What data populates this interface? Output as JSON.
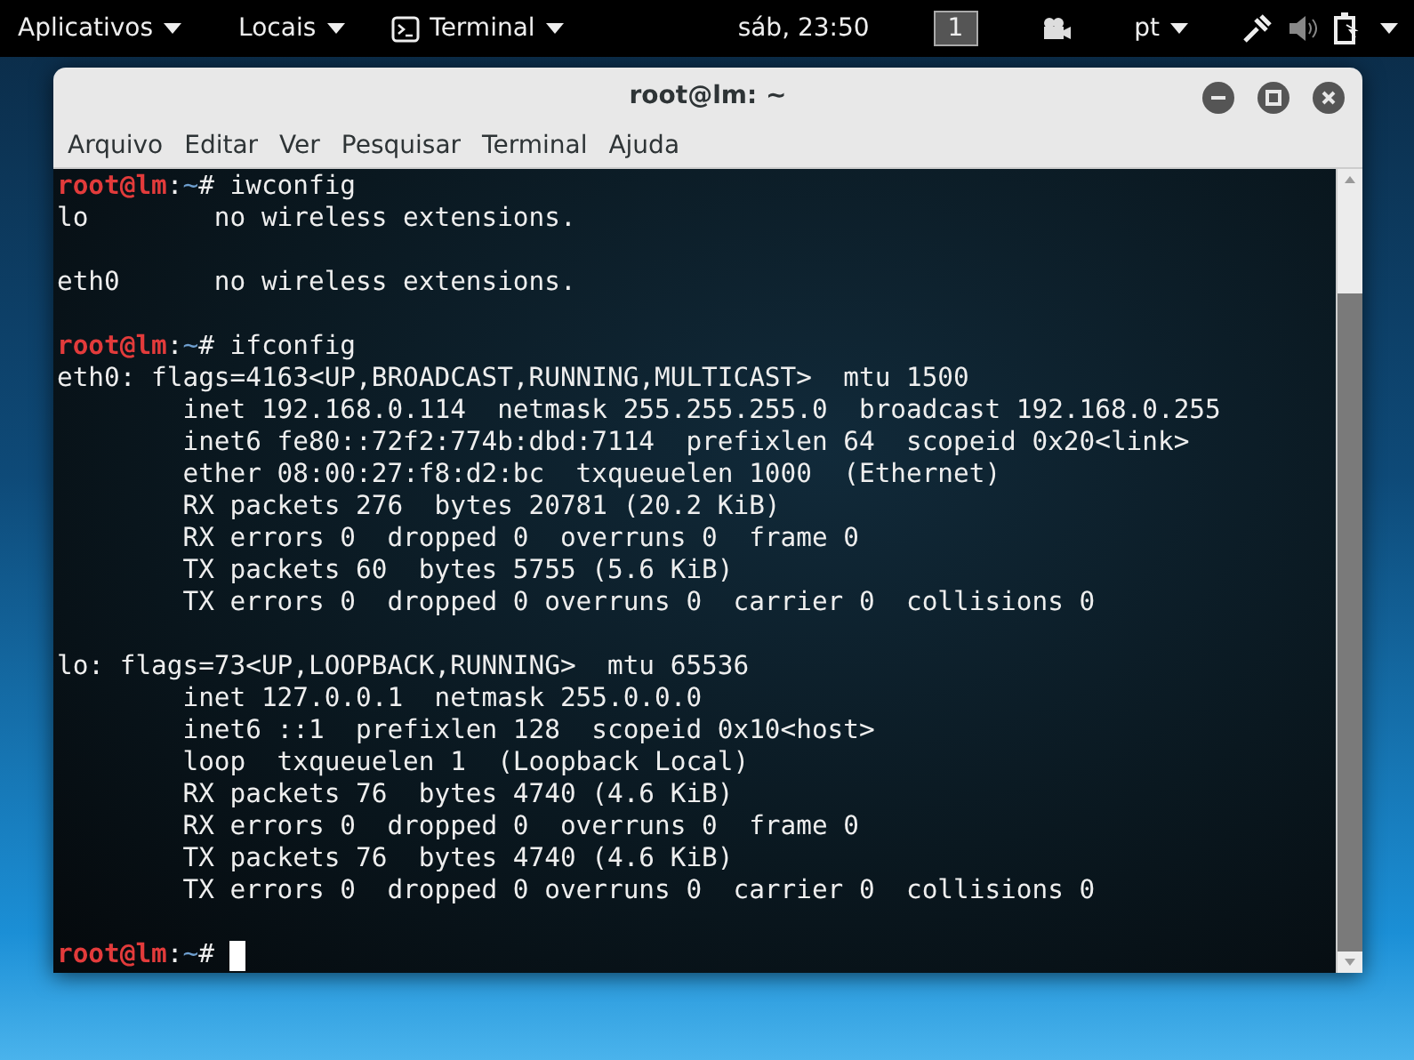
{
  "top_bar": {
    "menus": [
      {
        "label": "Aplicativos"
      },
      {
        "label": "Locais"
      },
      {
        "label": "Terminal"
      }
    ],
    "clock": "sáb, 23:50",
    "workspace": "1",
    "language": "pt"
  },
  "window": {
    "title": "root@lm: ~",
    "menu": [
      "Arquivo",
      "Editar",
      "Ver",
      "Pesquisar",
      "Terminal",
      "Ajuda"
    ]
  },
  "terminal": {
    "lines": [
      {
        "kind": "prompt",
        "user": "root@lm",
        "sep": ":",
        "path": "~",
        "symbol": "#",
        "command": " iwconfig"
      },
      {
        "kind": "output",
        "text": "lo        no wireless extensions."
      },
      {
        "kind": "blank"
      },
      {
        "kind": "output",
        "text": "eth0      no wireless extensions."
      },
      {
        "kind": "blank"
      },
      {
        "kind": "prompt",
        "user": "root@lm",
        "sep": ":",
        "path": "~",
        "symbol": "#",
        "command": " ifconfig"
      },
      {
        "kind": "output",
        "text": "eth0: flags=4163<UP,BROADCAST,RUNNING,MULTICAST>  mtu 1500"
      },
      {
        "kind": "output",
        "text": "        inet 192.168.0.114  netmask 255.255.255.0  broadcast 192.168.0.255"
      },
      {
        "kind": "output",
        "text": "        inet6 fe80::72f2:774b:dbd:7114  prefixlen 64  scopeid 0x20<link>"
      },
      {
        "kind": "output",
        "text": "        ether 08:00:27:f8:d2:bc  txqueuelen 1000  (Ethernet)"
      },
      {
        "kind": "output",
        "text": "        RX packets 276  bytes 20781 (20.2 KiB)"
      },
      {
        "kind": "output",
        "text": "        RX errors 0  dropped 0  overruns 0  frame 0"
      },
      {
        "kind": "output",
        "text": "        TX packets 60  bytes 5755 (5.6 KiB)"
      },
      {
        "kind": "output",
        "text": "        TX errors 0  dropped 0 overruns 0  carrier 0  collisions 0"
      },
      {
        "kind": "blank"
      },
      {
        "kind": "output",
        "text": "lo: flags=73<UP,LOOPBACK,RUNNING>  mtu 65536"
      },
      {
        "kind": "output",
        "text": "        inet 127.0.0.1  netmask 255.0.0.0"
      },
      {
        "kind": "output",
        "text": "        inet6 ::1  prefixlen 128  scopeid 0x10<host>"
      },
      {
        "kind": "output",
        "text": "        loop  txqueuelen 1  (Loopback Local)"
      },
      {
        "kind": "output",
        "text": "        RX packets 76  bytes 4740 (4.6 KiB)"
      },
      {
        "kind": "output",
        "text": "        RX errors 0  dropped 0  overruns 0  frame 0"
      },
      {
        "kind": "output",
        "text": "        TX packets 76  bytes 4740 (4.6 KiB)"
      },
      {
        "kind": "output",
        "text": "        TX errors 0  dropped 0 overruns 0  carrier 0  collisions 0"
      },
      {
        "kind": "blank"
      },
      {
        "kind": "prompt",
        "user": "root@lm",
        "sep": ":",
        "path": "~",
        "symbol": "#",
        "cursor": true
      }
    ]
  }
}
